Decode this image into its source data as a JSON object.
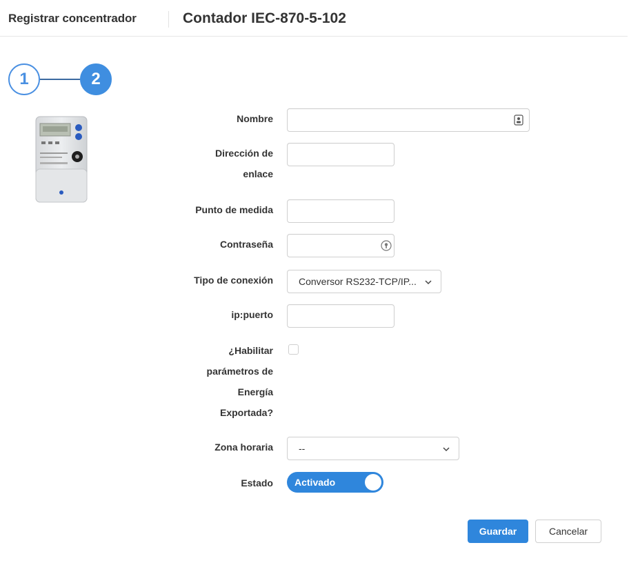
{
  "header": {
    "breadcrumb": "Registrar concentrador",
    "title": "Contador IEC-870-5-102"
  },
  "stepper": {
    "steps": [
      "1",
      "2"
    ],
    "current": 2
  },
  "device": {
    "icon": "electric-meter-image"
  },
  "form": {
    "nombre": {
      "label": "Nombre",
      "value": ""
    },
    "direccion_enlace": {
      "label_line1": "Dirección de",
      "label_line2": "enlace",
      "value": ""
    },
    "punto_medida": {
      "label": "Punto de medida",
      "value": ""
    },
    "contrasena": {
      "label": "Contraseña",
      "value": ""
    },
    "tipo_conexion": {
      "label": "Tipo de conexión",
      "value": "Conversor RS232-TCP/IP..."
    },
    "ip_puerto": {
      "label": "ip:puerto",
      "value": ""
    },
    "energia_exportada": {
      "label_line1": "¿Habilitar",
      "label_line2": "parámetros de",
      "label_line3": "Energía",
      "label_line4": "Exportada?",
      "checked": false
    },
    "zona_horaria": {
      "label": "Zona horaria",
      "value": "--"
    },
    "estado": {
      "label": "Estado",
      "toggle_label": "Activado",
      "on": true
    }
  },
  "actions": {
    "save_label": "Guardar",
    "cancel_label": "Cancelar"
  },
  "colors": {
    "accent": "#2f86dc",
    "step_outline": "#4a90e2",
    "border": "#cfcfcf"
  }
}
